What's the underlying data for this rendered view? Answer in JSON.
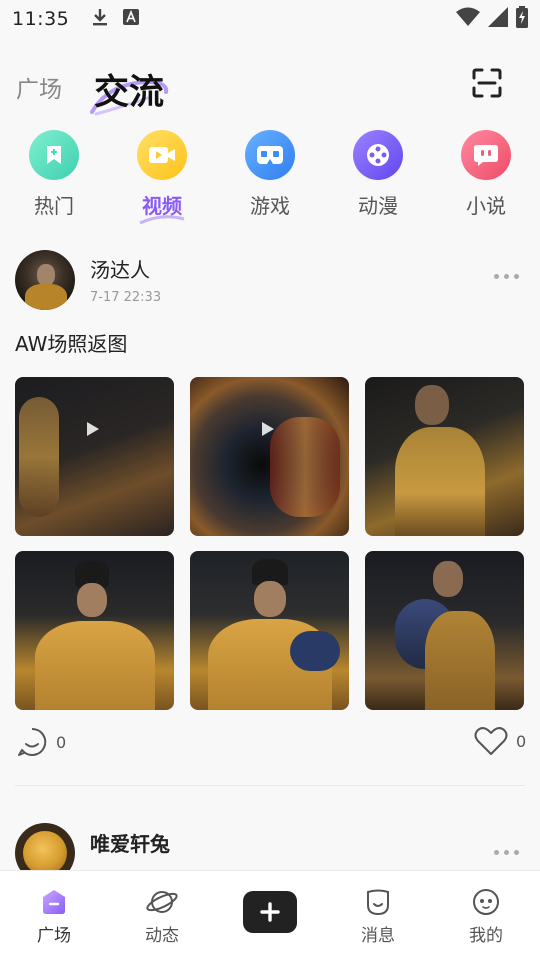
{
  "status_bar": {
    "time": "11:35"
  },
  "header": {
    "tab_square": "广场",
    "tab_exchange": "交流"
  },
  "categories": [
    {
      "label": "热门",
      "color": "#4fd8b8",
      "icon": "bookmark-icon"
    },
    {
      "label": "视频",
      "color": "#ffcc33",
      "icon": "video-icon"
    },
    {
      "label": "游戏",
      "color": "#3a8ef6",
      "icon": "vr-icon"
    },
    {
      "label": "动漫",
      "color": "#7b5cf5",
      "icon": "film-reel-icon"
    },
    {
      "label": "小说",
      "color": "#f25c74",
      "icon": "chat-bubble-icon"
    }
  ],
  "active_category": "视频",
  "post": {
    "username": "汤达人",
    "timestamp": "7-17 22:33",
    "text": "AW场照返图",
    "comment_count": "0",
    "like_count": "0"
  },
  "post2": {
    "username": "唯爱轩兔"
  },
  "bottom_nav": [
    {
      "label": "广场",
      "icon": "square-home-icon"
    },
    {
      "label": "动态",
      "icon": "planet-icon"
    },
    {
      "label": "",
      "icon": "add-icon"
    },
    {
      "label": "消息",
      "icon": "message-icon"
    },
    {
      "label": "我的",
      "icon": "profile-face-icon"
    }
  ],
  "colors": {
    "accent": "#8a5cf5"
  }
}
